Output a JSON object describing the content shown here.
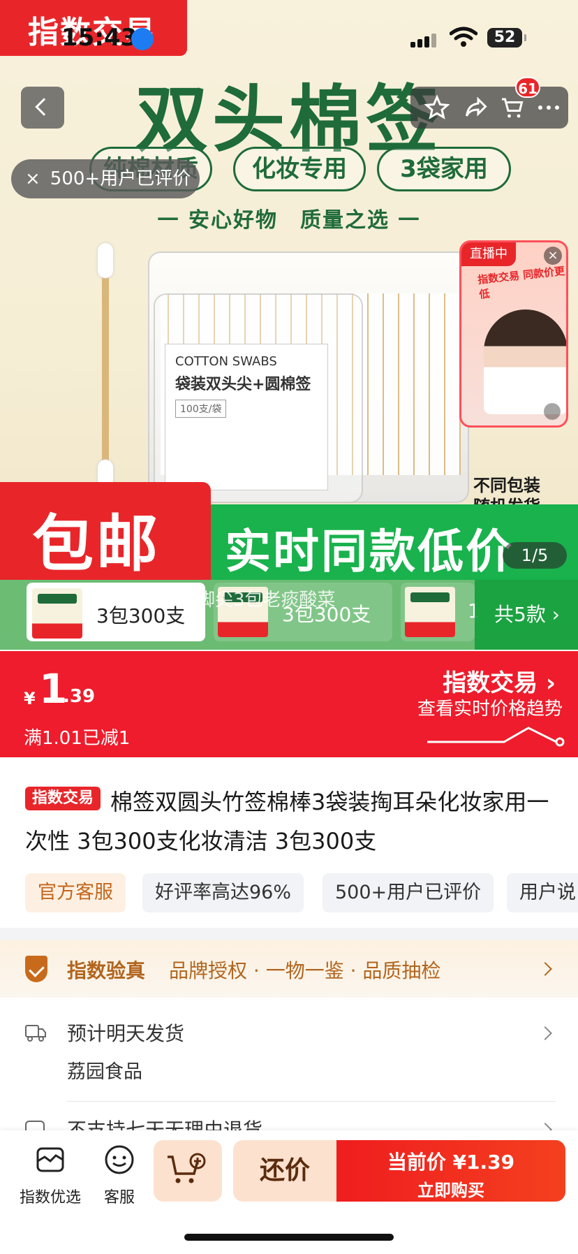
{
  "status_bar": {
    "time": "15:43",
    "battery": "52"
  },
  "brand_tag": "指数交易",
  "hero": {
    "title": "双头棉签",
    "pills": [
      "纯棉材质",
      "化妆专用",
      "3袋家用"
    ],
    "subtitle": "一 安心好物　质量之选 一",
    "pack_label_en": "COTTON SWABS",
    "pack_label_cn": "袋装双头尖+圆棉签",
    "pack_label_count": "100支/袋",
    "pack_note_line1": "不同包装",
    "pack_note_line2": "随机发货",
    "banner_left": "包邮",
    "banner_right": "实时同款低价",
    "image_counter": "1/5"
  },
  "nav": {
    "cart_badge": "61"
  },
  "rating_chip": {
    "close": "×",
    "text": "500+用户已评价"
  },
  "live_popup": {
    "tag": "直播中",
    "close": "×",
    "headline": "指数交易 同款价更低"
  },
  "variants": {
    "items": [
      {
        "label": "3包300支"
      },
      {
        "label": "3包300支"
      },
      {
        "label": "1"
      }
    ],
    "more": "共5款 ›",
    "danmaku": "脚尖3包老痰酸菜"
  },
  "price": {
    "currency": "¥",
    "integer": "1",
    "decimal": ".39",
    "discount": "满1.01已减1",
    "trend_title": "指数交易 ›",
    "trend_subtitle": "查看实时价格趋势"
  },
  "product": {
    "tag": "指数交易",
    "title": "棉签双圆头竹签棉棒3袋装掏耳朵化妆家用一次性 3包300支化妆清洁 3包300支",
    "chips": [
      "官方客服",
      "好评率高达96%",
      "500+用户已评价",
      "用户说"
    ]
  },
  "verify": {
    "title": "指数验真",
    "desc": "品牌授权 · 一物一鉴 · 品质抽检"
  },
  "shipping": {
    "label": "预计明天发货",
    "store": "荔园食品",
    "returns": "不支持七天无理由退货"
  },
  "bottom_bar": {
    "home_label": "指数优选",
    "service_label": "客服",
    "bargain": "还价",
    "buy_price": "当前价 ¥1.39",
    "buy_label": "立即购买"
  },
  "colors": {
    "brand_red": "#e8262a",
    "hero_green": "#1f6b3a",
    "banner_green": "#19b24d",
    "verify_brown": "#b2651e"
  }
}
